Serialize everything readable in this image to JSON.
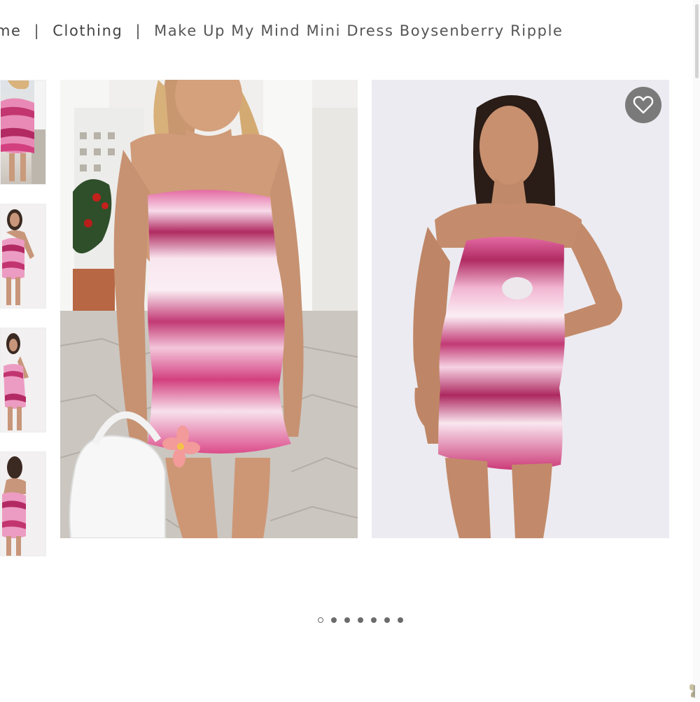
{
  "breadcrumb": {
    "items": [
      {
        "label": "me"
      },
      {
        "label": "Clothing"
      },
      {
        "label": "Make Up My Mind Mini Dress Boysenberry Ripple"
      }
    ],
    "separator": "|"
  },
  "gallery": {
    "thumbnails": [
      "thumbnail-1",
      "thumbnail-2",
      "thumbnail-3",
      "thumbnail-4"
    ],
    "images": [
      "product-photo-lifestyle",
      "product-photo-studio"
    ],
    "wishlist_icon": "heart-outline-icon",
    "pagination": {
      "total": 7,
      "active_index": 0
    }
  },
  "colors": {
    "dress_pink": "#d3407f",
    "dress_light": "#f7dbe9",
    "wishlist_bg": "#7a7a7a"
  }
}
